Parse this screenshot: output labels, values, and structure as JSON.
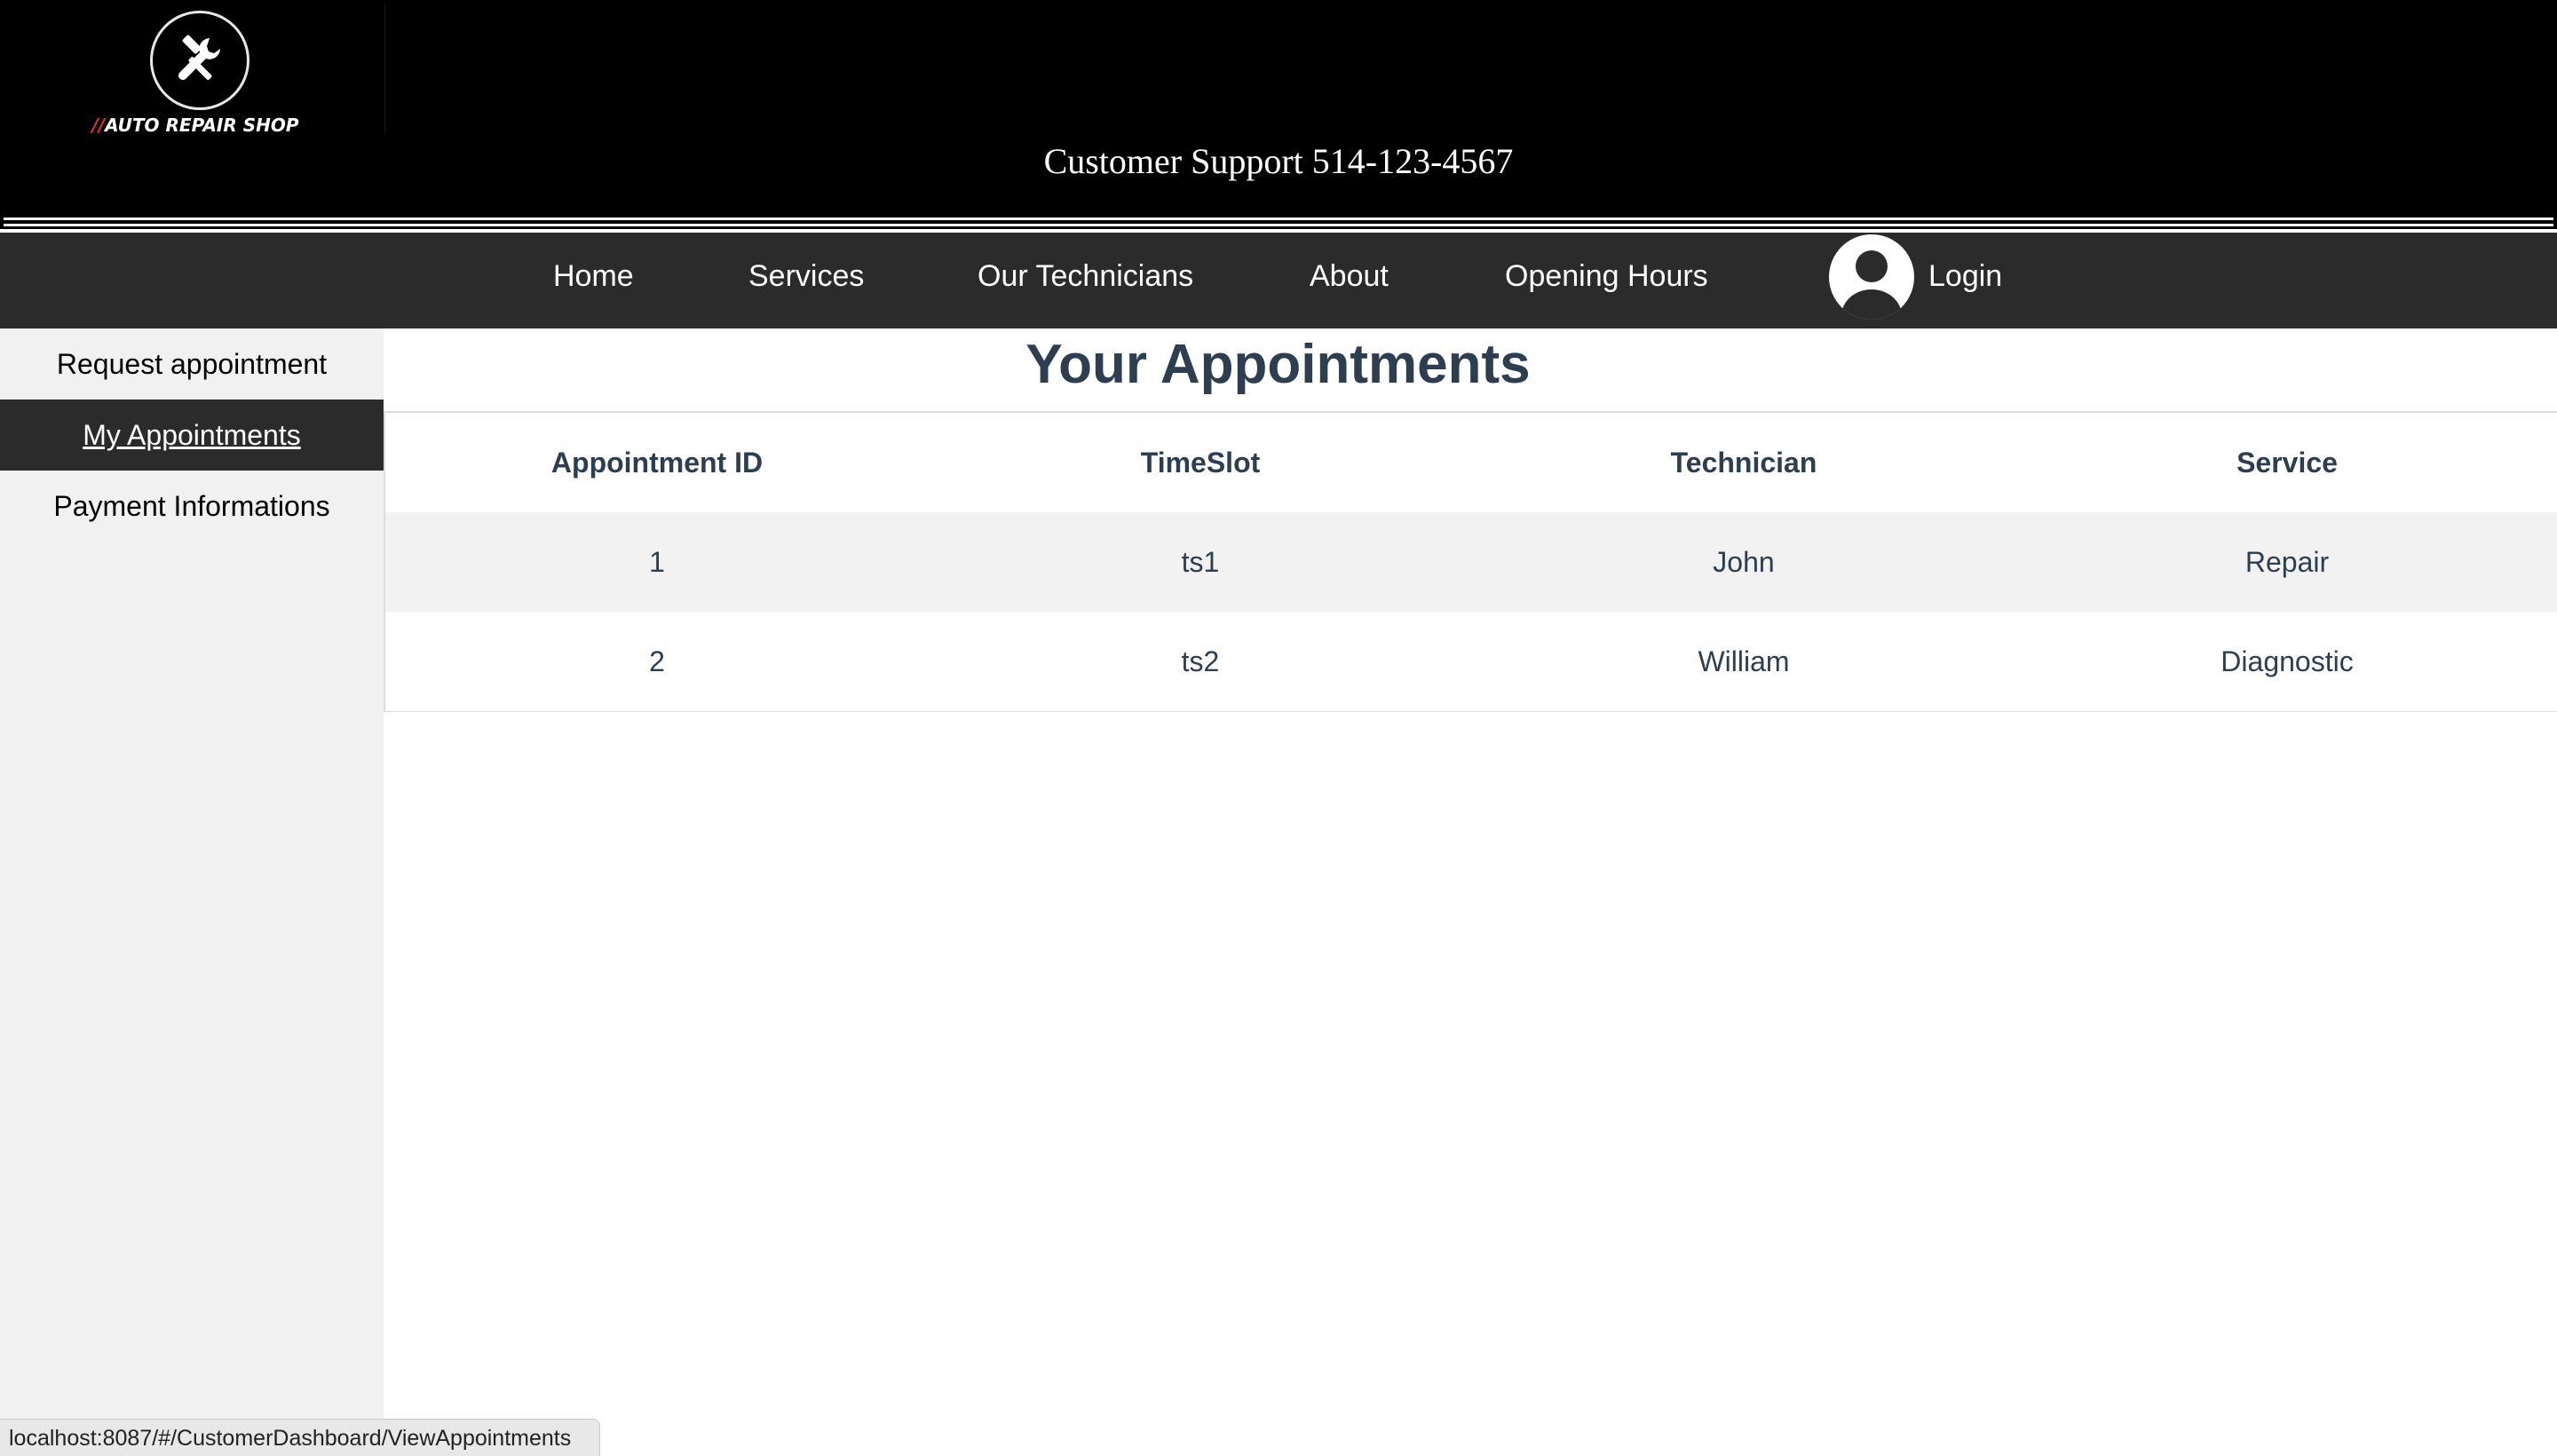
{
  "header": {
    "logo_slashes": "//",
    "logo_text": "AUTO REPAIR SHOP",
    "support": "Customer Support 514-123-4567"
  },
  "nav": {
    "home": "Home",
    "services": "Services",
    "technicians": "Our Technicians",
    "about": "About",
    "opening_hours": "Opening Hours",
    "login": "Login"
  },
  "sidebar": {
    "items": [
      {
        "label": "Request appointment"
      },
      {
        "label": "My Appointments",
        "active": true
      },
      {
        "label": "Payment Informations"
      }
    ]
  },
  "main": {
    "title": "Your Appointments",
    "table": {
      "headers": [
        "Appointment ID",
        "TimeSlot",
        "Technician",
        "Service"
      ],
      "rows": [
        [
          "1",
          "ts1",
          "John",
          "Repair"
        ],
        [
          "2",
          "ts2",
          "William",
          "Diagnostic"
        ]
      ]
    }
  },
  "statusbar": {
    "url": "localhost:8087/#/CustomerDashboard/ViewAppointments"
  },
  "colors": {
    "header_bg": "#000000",
    "nav_bg": "#2b2b2b",
    "sidebar_bg": "#f1f1f1",
    "active_item_bg": "#2b2b2b",
    "title_text": "#2c3e50",
    "striped_row": "#f2f2f2",
    "logo_accent": "#e0342a"
  },
  "icons": {
    "logo": "hammer-wrench-icon",
    "avatar": "user-avatar-icon"
  }
}
